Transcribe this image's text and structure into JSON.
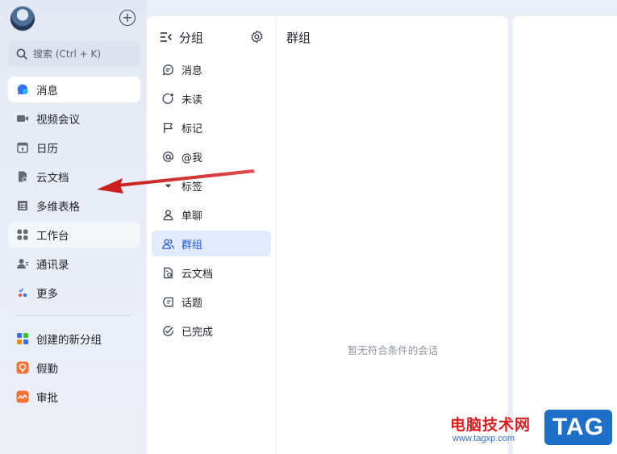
{
  "sidebar": {
    "search_placeholder": "搜索 (Ctrl + K)",
    "items": [
      {
        "label": "消息",
        "icon": "message-bubble-icon"
      },
      {
        "label": "视频会议",
        "icon": "video-camera-icon"
      },
      {
        "label": "日历",
        "icon": "calendar-icon"
      },
      {
        "label": "云文档",
        "icon": "cloud-doc-icon"
      },
      {
        "label": "多维表格",
        "icon": "base-table-icon"
      },
      {
        "label": "工作台",
        "icon": "workplace-grid-icon"
      },
      {
        "label": "通讯录",
        "icon": "contacts-icon"
      },
      {
        "label": "更多",
        "icon": "more-apps-icon"
      }
    ],
    "custom_items": [
      {
        "label": "创建的新分组",
        "icon": "new-group-icon"
      },
      {
        "label": "假勤",
        "icon": "attendance-icon"
      },
      {
        "label": "审批",
        "icon": "approval-icon"
      }
    ]
  },
  "filter_panel": {
    "title": "分组",
    "items": [
      {
        "label": "消息",
        "icon": "message-icon"
      },
      {
        "label": "未读",
        "icon": "unread-icon"
      },
      {
        "label": "标记",
        "icon": "flag-icon"
      },
      {
        "label": "@我",
        "icon": "at-icon"
      },
      {
        "label": "标签",
        "icon": "tag-caret-icon"
      },
      {
        "label": "单聊",
        "icon": "person-icon"
      },
      {
        "label": "群组",
        "icon": "group-icon"
      },
      {
        "label": "云文档",
        "icon": "doc-icon"
      },
      {
        "label": "话题",
        "icon": "topic-icon"
      },
      {
        "label": "已完成",
        "icon": "done-icon"
      }
    ],
    "active_index": 6
  },
  "content": {
    "title": "群组",
    "empty_message": "暂无符合条件的会话"
  },
  "watermark": {
    "site_name": "电脑技术网",
    "url": "www.tagxp.com",
    "tag": "TAG"
  },
  "colors": {
    "accent": "#245bdb",
    "active_bg": "#e1eaff",
    "arrow": "#d42a2a"
  }
}
